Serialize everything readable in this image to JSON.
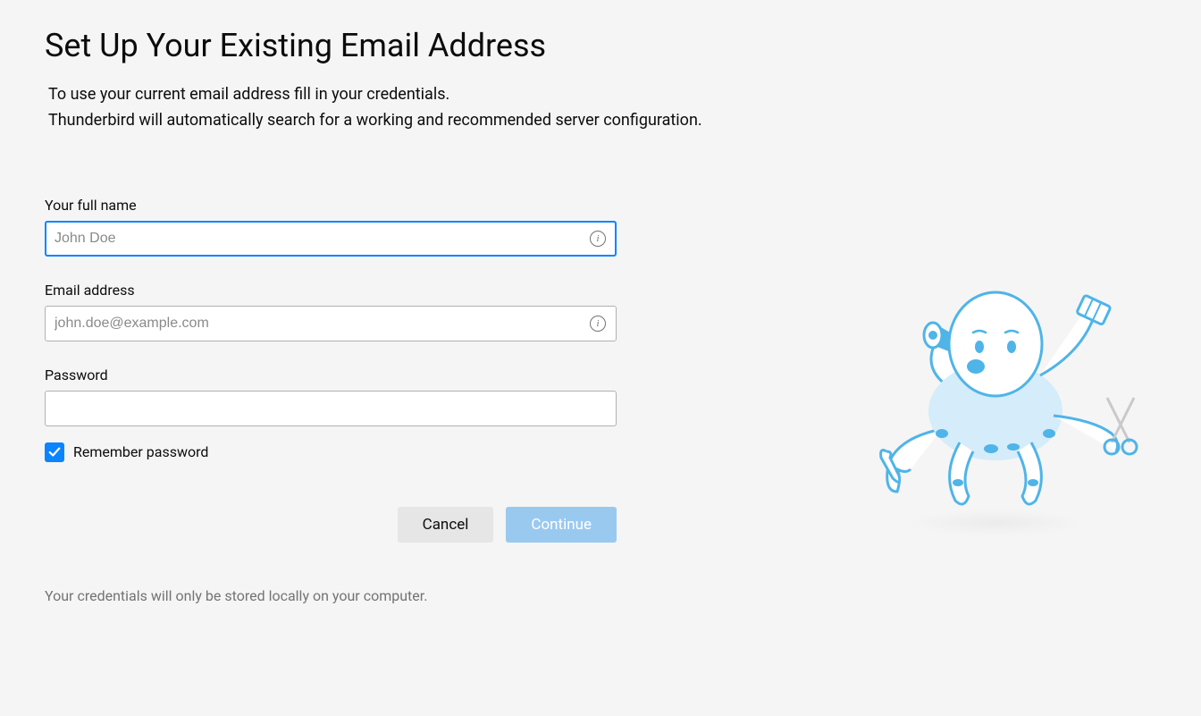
{
  "page": {
    "title": "Set Up Your Existing Email Address",
    "intro_line1": "To use your current email address fill in your credentials.",
    "intro_line2": "Thunderbird will automatically search for a working and recommended server configuration."
  },
  "form": {
    "fullname": {
      "label": "Your full name",
      "placeholder": "John Doe",
      "value": ""
    },
    "email": {
      "label": "Email address",
      "placeholder": "john.doe@example.com",
      "value": ""
    },
    "password": {
      "label": "Password",
      "placeholder": "",
      "value": ""
    },
    "remember": {
      "label": "Remember password",
      "checked": true
    }
  },
  "buttons": {
    "cancel": "Cancel",
    "continue": "Continue"
  },
  "footer": {
    "text": "Your credentials will only be stored locally on your computer."
  }
}
